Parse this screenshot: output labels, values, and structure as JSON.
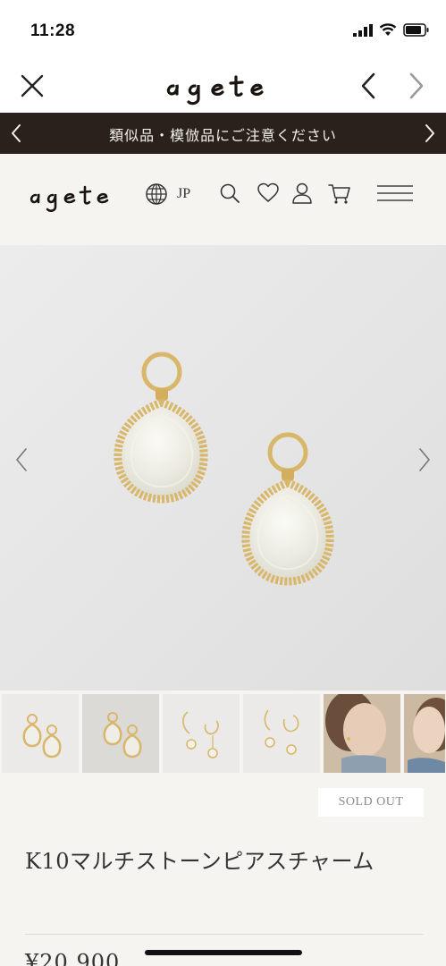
{
  "status_bar": {
    "time": "11:28"
  },
  "browser": {
    "logo_text": "agete"
  },
  "notice": {
    "text": "類似品・模倣品にご注意ください"
  },
  "header": {
    "logo_text": "agete",
    "language": "JP"
  },
  "product": {
    "sold_out_label": "SOLD OUT",
    "title": "K10マルチストーンピアスチャーム",
    "price": "¥20,900"
  },
  "colors": {
    "notice_bg": "#2a211d",
    "page_bg": "#f6f4f0",
    "gold": "#d8b66a"
  }
}
